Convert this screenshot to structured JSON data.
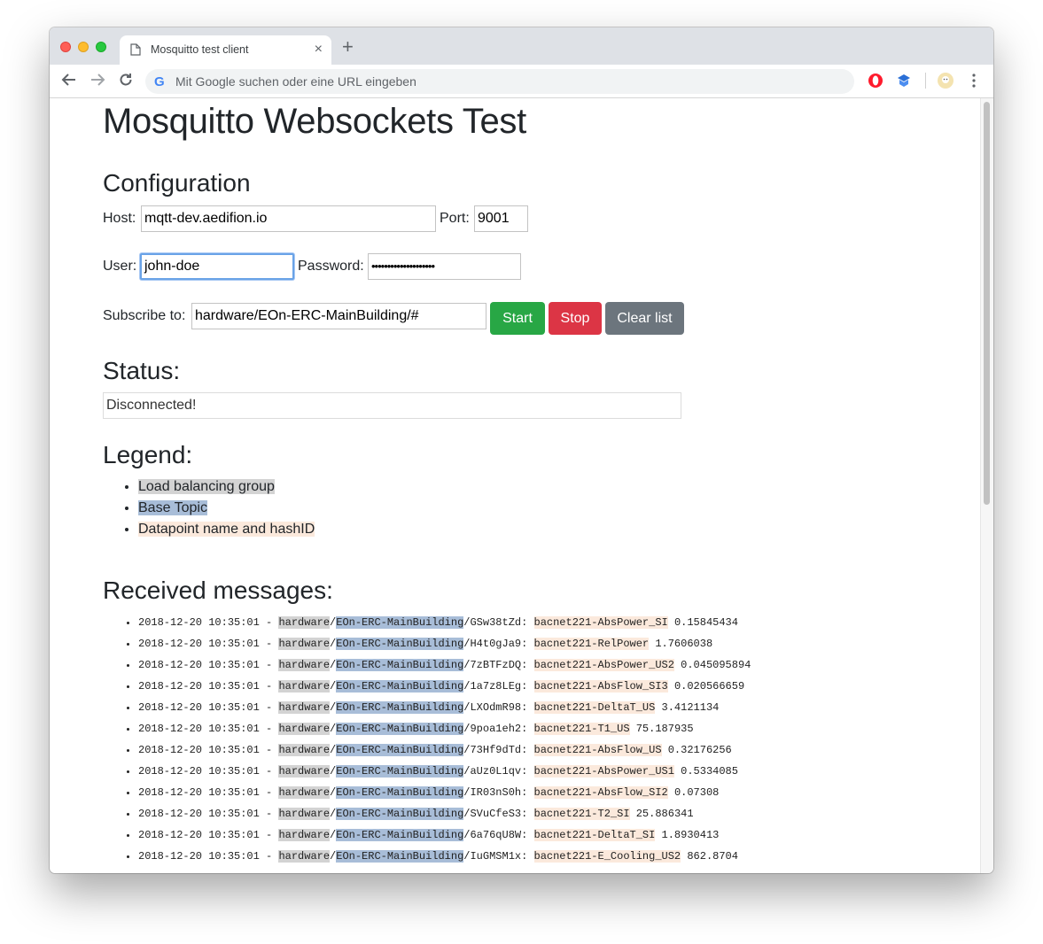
{
  "browser": {
    "tab_title": "Mosquitto test client",
    "new_tab_glyph": "+",
    "close_glyph": "×",
    "omnibox_placeholder": "Mit Google suchen oder eine URL eingeben",
    "google_glyph": "G",
    "icons": [
      "back-icon",
      "forward-icon",
      "reload-icon",
      "opera-icon",
      "extension-icon",
      "profile-avatar-icon",
      "menu-icon"
    ]
  },
  "page": {
    "title": "Mosquitto Websockets Test",
    "config": {
      "heading": "Configuration",
      "host_label": "Host:",
      "host_value": "mqtt-dev.aedifion.io",
      "port_label": "Port:",
      "port_value": "9001",
      "user_label": "User:",
      "user_value": "john-doe",
      "password_label": "Password:",
      "password_value": "••••••••••••••••••••",
      "subscribe_label": "Subscribe to:",
      "subscribe_value": "hardware/EOn-ERC-MainBuilding/#",
      "start_label": "Start",
      "stop_label": "Stop",
      "clear_label": "Clear list"
    },
    "status": {
      "heading": "Status:",
      "text": "Disconnected!"
    },
    "legend": {
      "heading": "Legend:",
      "items": [
        "Load balancing group",
        "Base Topic",
        "Datapoint name and hashID"
      ]
    },
    "messages": {
      "heading": "Received messages:",
      "items": [
        {
          "time": "2018-12-20 10:35:01 - ",
          "group": "hardware",
          "base": "EOn-ERC-MainBuilding",
          "hash": "GSw38tZd",
          "dp": "bacnet221-AbsPower_SI",
          "value": "0.15845434"
        },
        {
          "time": "2018-12-20 10:35:01 - ",
          "group": "hardware",
          "base": "EOn-ERC-MainBuilding",
          "hash": "H4t0gJa9",
          "dp": "bacnet221-RelPower",
          "value": "1.7606038"
        },
        {
          "time": "2018-12-20 10:35:01 - ",
          "group": "hardware",
          "base": "EOn-ERC-MainBuilding",
          "hash": "7zBTFzDQ",
          "dp": "bacnet221-AbsPower_US2",
          "value": "0.045095894"
        },
        {
          "time": "2018-12-20 10:35:01 - ",
          "group": "hardware",
          "base": "EOn-ERC-MainBuilding",
          "hash": "1a7z8LEg",
          "dp": "bacnet221-AbsFlow_SI3",
          "value": "0.020566659"
        },
        {
          "time": "2018-12-20 10:35:01 - ",
          "group": "hardware",
          "base": "EOn-ERC-MainBuilding",
          "hash": "LXOdmR98",
          "dp": "bacnet221-DeltaT_US",
          "value": "3.4121134"
        },
        {
          "time": "2018-12-20 10:35:01 - ",
          "group": "hardware",
          "base": "EOn-ERC-MainBuilding",
          "hash": "9poa1eh2",
          "dp": "bacnet221-T1_US",
          "value": "75.187935"
        },
        {
          "time": "2018-12-20 10:35:01 - ",
          "group": "hardware",
          "base": "EOn-ERC-MainBuilding",
          "hash": "73Hf9dTd",
          "dp": "bacnet221-AbsFlow_US",
          "value": "0.32176256"
        },
        {
          "time": "2018-12-20 10:35:01 - ",
          "group": "hardware",
          "base": "EOn-ERC-MainBuilding",
          "hash": "aUz0L1qv",
          "dp": "bacnet221-AbsPower_US1",
          "value": "0.5334085"
        },
        {
          "time": "2018-12-20 10:35:01 - ",
          "group": "hardware",
          "base": "EOn-ERC-MainBuilding",
          "hash": "IR03nS0h",
          "dp": "bacnet221-AbsFlow_SI2",
          "value": "0.07308"
        },
        {
          "time": "2018-12-20 10:35:01 - ",
          "group": "hardware",
          "base": "EOn-ERC-MainBuilding",
          "hash": "SVuCfeS3",
          "dp": "bacnet221-T2_SI",
          "value": "25.886341"
        },
        {
          "time": "2018-12-20 10:35:01 - ",
          "group": "hardware",
          "base": "EOn-ERC-MainBuilding",
          "hash": "6a76qU8W",
          "dp": "bacnet221-DeltaT_SI",
          "value": "1.8930413"
        },
        {
          "time": "2018-12-20 10:35:01 - ",
          "group": "hardware",
          "base": "EOn-ERC-MainBuilding",
          "hash": "IuGMSM1x",
          "dp": "bacnet221-E_Cooling_US2",
          "value": "862.8704"
        }
      ]
    }
  },
  "colors": {
    "start": "#28a745",
    "stop": "#dc3545",
    "clear": "#6c757d",
    "group_highlight": "#d3d3d3",
    "base_highlight": "#a8bdd8",
    "datapoint_highlight": "#fbe9dc"
  }
}
